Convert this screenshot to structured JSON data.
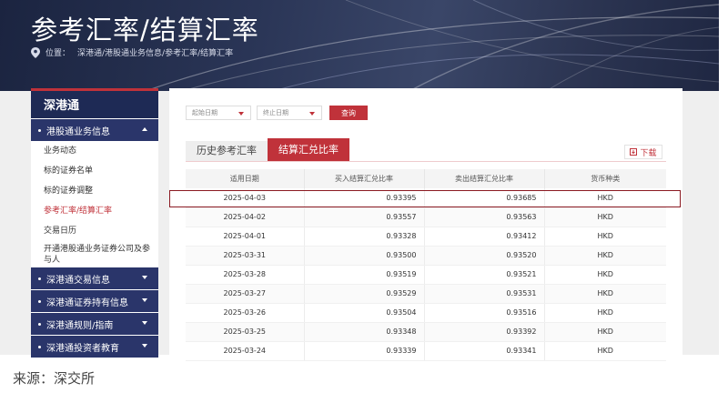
{
  "banner": {
    "title": "参考汇率/结算汇率",
    "breadcrumb_label": "位置：",
    "breadcrumb_path": "深港通/港股通业务信息/参考汇率/结算汇率"
  },
  "sidebar": {
    "heading": "深港通",
    "groups": [
      {
        "label": "港股通业务信息",
        "expanded": true
      },
      {
        "label": "深港通交易信息",
        "expanded": false
      },
      {
        "label": "深港通证券持有信息",
        "expanded": false
      },
      {
        "label": "深港通规则/指南",
        "expanded": false
      },
      {
        "label": "深港通投资者教育",
        "expanded": false
      }
    ],
    "items": [
      {
        "label": "业务动态"
      },
      {
        "label": "标的证券名单"
      },
      {
        "label": "标的证券调整"
      },
      {
        "label": "参考汇率/结算汇率",
        "active": true
      },
      {
        "label": "交易日历"
      },
      {
        "label": "开通港股通业务证券公司及参与人"
      }
    ]
  },
  "filter": {
    "start_placeholder": "起始日期",
    "end_placeholder": "终止日期",
    "query_label": "查询"
  },
  "tabs": [
    {
      "label": "历史参考汇率",
      "active": false
    },
    {
      "label": "结算汇兑比率",
      "active": true
    }
  ],
  "download_label": "下载",
  "table": {
    "headers": [
      "适用日期",
      "买入结算汇兑比率",
      "卖出结算汇兑比率",
      "货币种类"
    ],
    "rows": [
      [
        "2025-04-03",
        "0.93395",
        "0.93685",
        "HKD"
      ],
      [
        "2025-04-02",
        "0.93557",
        "0.93563",
        "HKD"
      ],
      [
        "2025-04-01",
        "0.93328",
        "0.93412",
        "HKD"
      ],
      [
        "2025-03-31",
        "0.93500",
        "0.93520",
        "HKD"
      ],
      [
        "2025-03-28",
        "0.93519",
        "0.93521",
        "HKD"
      ],
      [
        "2025-03-27",
        "0.93529",
        "0.93531",
        "HKD"
      ],
      [
        "2025-03-26",
        "0.93504",
        "0.93516",
        "HKD"
      ],
      [
        "2025-03-25",
        "0.93348",
        "0.93392",
        "HKD"
      ],
      [
        "2025-03-24",
        "0.93339",
        "0.93341",
        "HKD"
      ]
    ]
  },
  "source_note": "来源：深交所",
  "colors": {
    "accent": "#c0323a",
    "navy": "#1e2a55",
    "highlight_border": "#8b1a22"
  }
}
